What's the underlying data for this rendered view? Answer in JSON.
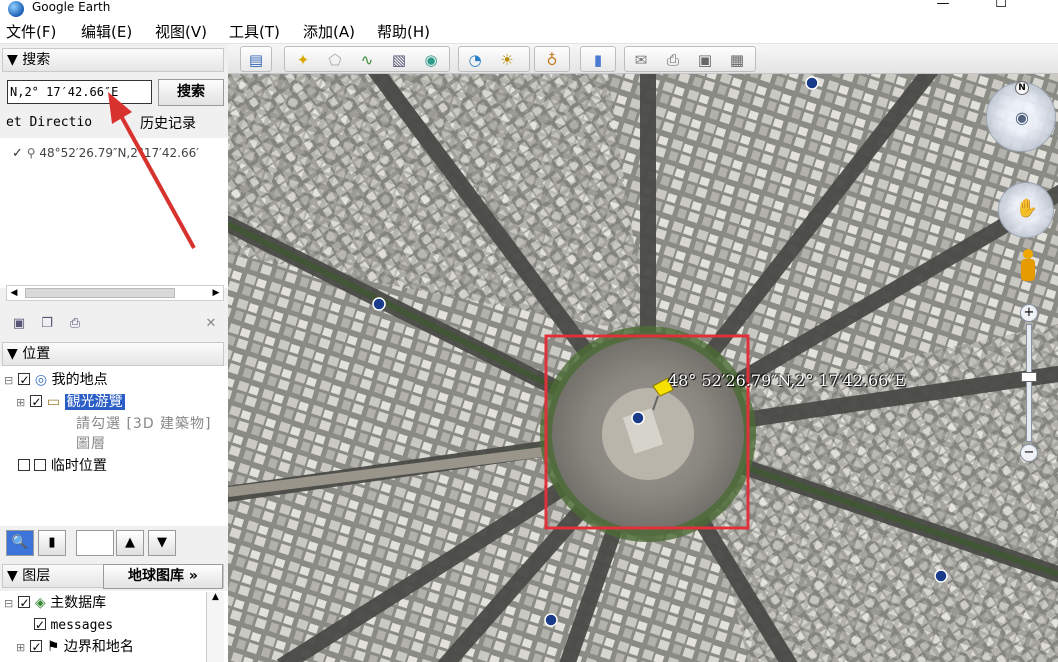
{
  "window": {
    "title": "Google Earth",
    "minimize": "—",
    "maximize": "☐"
  },
  "menu": [
    "文件(F)",
    "编辑(E)",
    "视图(V)",
    "工具(T)",
    "添加(A)",
    "帮助(H)"
  ],
  "search_panel": {
    "header": "搜索",
    "input_value": "N,2° 17′42.66″E",
    "button": "搜索",
    "tab_directions": "et Directio",
    "tab_history": "历史记录",
    "result": "48°52′26.79″N,2°17′42.66′"
  },
  "places_panel": {
    "header": "位置",
    "items": {
      "my_places": "我的地点",
      "sightseeing": "観光游覽",
      "sightseeing_note": "請勾選 [3D 建築物] 圖層",
      "temporary": "临时位置"
    }
  },
  "layers_panel": {
    "header": "图层",
    "gallery_button": "地球图库 »",
    "items": {
      "primary_db": "主数据库",
      "messages": "messages",
      "borders": "边界和地名"
    }
  },
  "map": {
    "placemark_label": "48° 52′26.79″N,2° 17′42.66″E",
    "highlight_color": "#e0303a",
    "pin_color": "#f5e000"
  }
}
